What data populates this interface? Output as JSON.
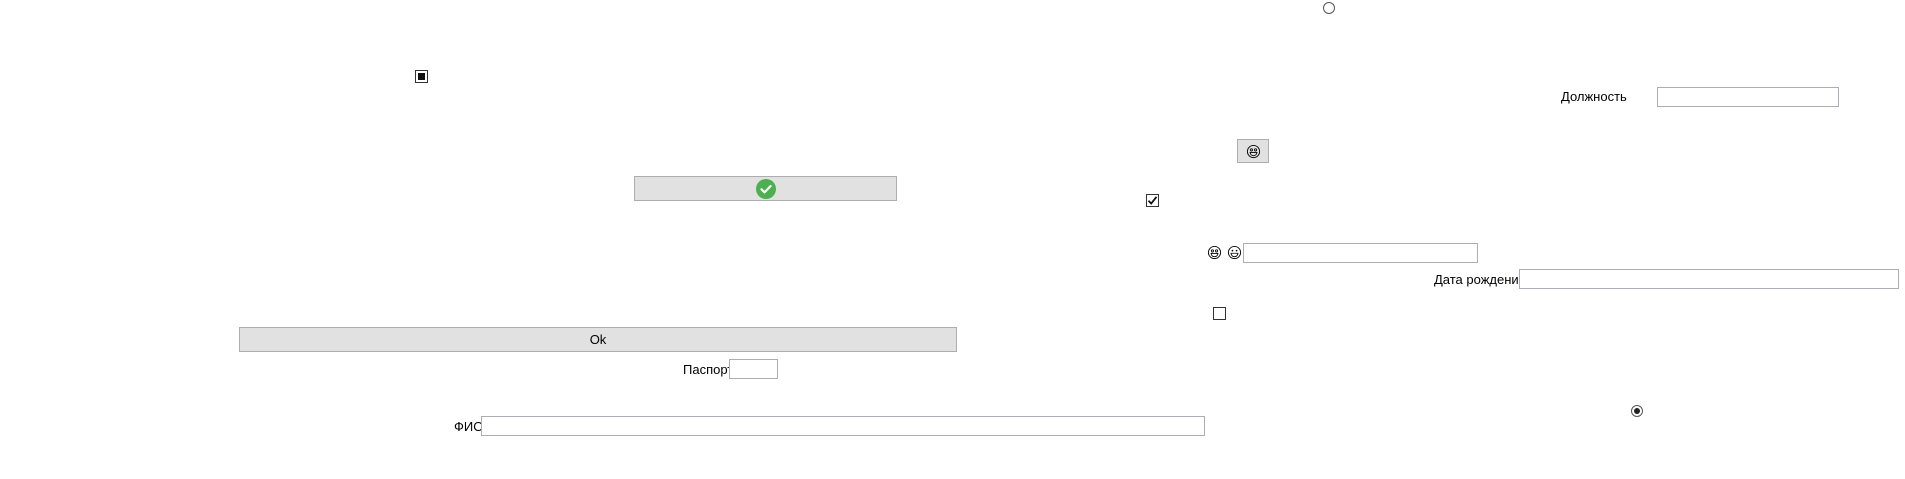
{
  "labels": {
    "position": "Должность",
    "birth_date": "Дата рождения",
    "passport": "Паспорт",
    "full_name": "ФИО"
  },
  "buttons": {
    "ok": "Ok"
  },
  "inputs": {
    "position_value": "",
    "birth_date_value": "",
    "passport_value": "",
    "full_name_value": "",
    "emoji_field_value": ""
  },
  "checkboxes": {
    "indeterminate": "indeterminate",
    "checked": "checked",
    "unchecked": "unchecked"
  },
  "radios": {
    "top": "unselected",
    "bottom": "selected"
  },
  "icons": {
    "confirm": "check-circle-icon",
    "emoji_button": "grinning-face-icon",
    "emoji_a": "grinning-face-icon",
    "emoji_b": "grinning-face-icon"
  },
  "colors": {
    "confirm_green": "#4caf50",
    "button_bg": "#e1e1e1"
  }
}
